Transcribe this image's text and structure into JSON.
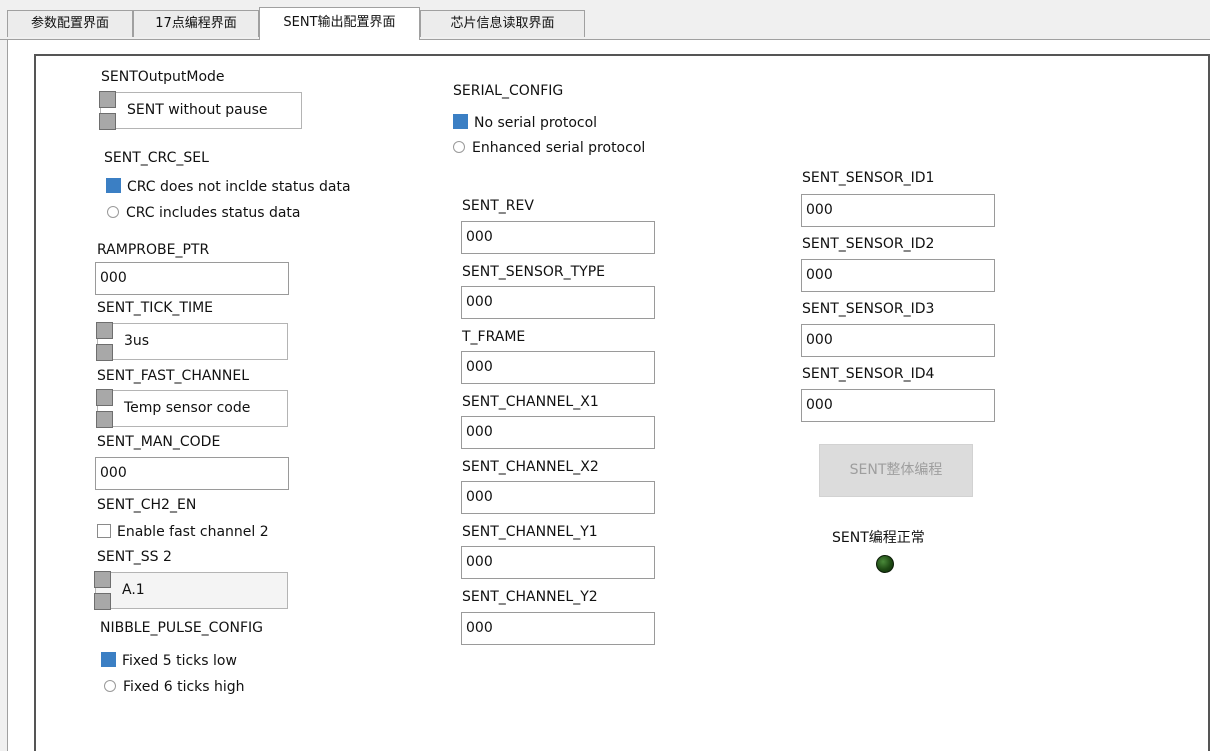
{
  "tabs": [
    {
      "label": "参数配置界面"
    },
    {
      "label": "17点编程界面"
    },
    {
      "label": "SENT输出配置界面"
    },
    {
      "label": "芯片信息读取界面"
    }
  ],
  "col1": {
    "output_mode_label": "SENTOutputMode",
    "output_mode_value": "SENT without pause",
    "crc_sel_label": "SENT_CRC_SEL",
    "crc_opt1": "CRC does not inclde status data",
    "crc_opt2": "CRC includes status data",
    "ramprobe_label": "RAMPROBE_PTR",
    "ramprobe_value": "000",
    "tick_time_label": "SENT_TICK_TIME",
    "tick_time_value": "3us",
    "fast_channel_label": "SENT_FAST_CHANNEL",
    "fast_channel_value": "Temp sensor code",
    "man_code_label": "SENT_MAN_CODE",
    "man_code_value": "000",
    "ch2_en_label": "SENT_CH2_EN",
    "ch2_en_checkbox": "Enable fast channel 2",
    "ss2_label": "SENT_SS 2",
    "ss2_value": "A.1",
    "nibble_label": "NIBBLE_PULSE_CONFIG",
    "nibble_opt1": "Fixed 5 ticks low",
    "nibble_opt2": "Fixed 6 ticks high"
  },
  "col2": {
    "serial_label": "SERIAL_CONFIG",
    "serial_opt1": "No serial protocol",
    "serial_opt2": "Enhanced serial protocol",
    "rev_label": "SENT_REV",
    "rev_value": "000",
    "sensor_type_label": "SENT_SENSOR_TYPE",
    "sensor_type_value": "000",
    "t_frame_label": "T_FRAME",
    "t_frame_value": "000",
    "ch_x1_label": "SENT_CHANNEL_X1",
    "ch_x1_value": "000",
    "ch_x2_label": "SENT_CHANNEL_X2",
    "ch_x2_value": "000",
    "ch_y1_label": "SENT_CHANNEL_Y1",
    "ch_y1_value": "000",
    "ch_y2_label": "SENT_CHANNEL_Y2",
    "ch_y2_value": "000"
  },
  "col3": {
    "id1_label": "SENT_SENSOR_ID1",
    "id1_value": "000",
    "id2_label": "SENT_SENSOR_ID2",
    "id2_value": "000",
    "id3_label": "SENT_SENSOR_ID3",
    "id3_value": "000",
    "id4_label": "SENT_SENSOR_ID4",
    "id4_value": "000",
    "program_button": "SENT整体编程",
    "status_label": "SENT编程正常"
  },
  "colors": {
    "selected_indicator": "#3b7fc4",
    "led_off": "#1e4a14",
    "panel_border": "#555555"
  }
}
